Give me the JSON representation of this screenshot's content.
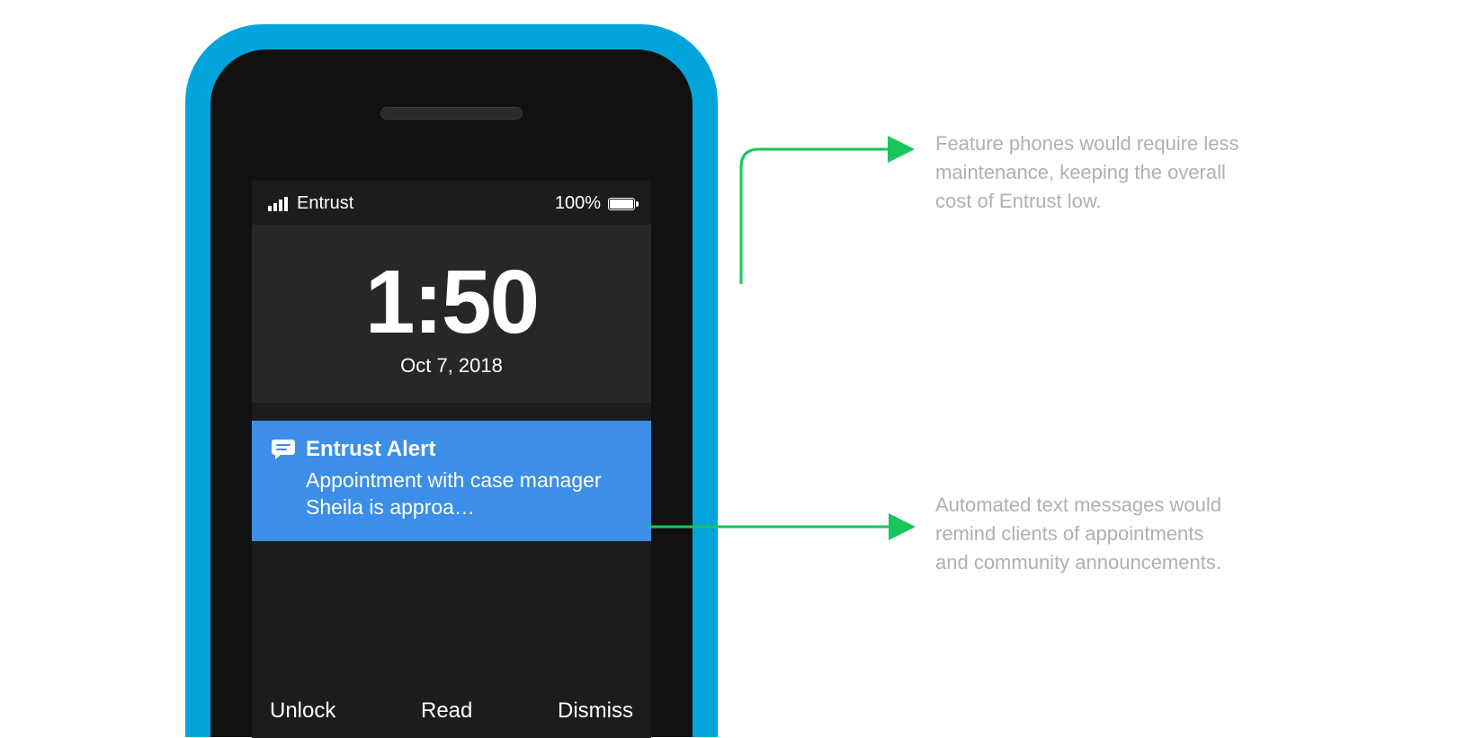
{
  "statusbar": {
    "carrier": "Entrust",
    "battery_text": "100%"
  },
  "clock": {
    "time": "1:50",
    "date": "Oct 7, 2018"
  },
  "notification": {
    "title": "Entrust Alert",
    "body": "Appointment with case manager Sheila is approa…"
  },
  "softkeys": {
    "left": "Unlock",
    "center": "Read",
    "right": "Dismiss"
  },
  "annotations": {
    "a1": "Feature phones would require less maintenance, keeping the overall cost of Entrust low.",
    "a2": "Automated text messages would remind clients of appointments and community announcements."
  },
  "colors": {
    "phone_case": "#03A4DB",
    "notification_bg": "#3C8EE6",
    "arrow": "#19C65C"
  }
}
